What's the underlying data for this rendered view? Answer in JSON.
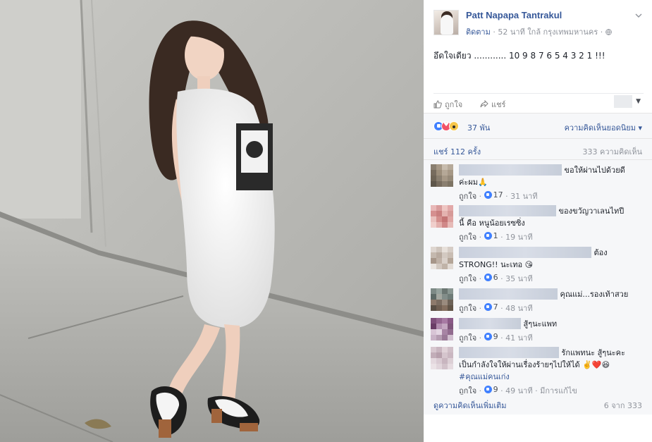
{
  "post": {
    "author": "Patt Napapa Tantrakul",
    "follow_label": "ติดตาม",
    "meta": " · 52 นาที ใกล้ กรุงเทพมหานคร ·",
    "text": "อึดใจเดียว ............ 10 9 8 7 6 5 4 3 2 1 !!!",
    "like_label": "ถูกใจ",
    "share_label": "แชร์",
    "reaction_count": "37 พัน",
    "top_comments_label": "ความคิดเห็นยอดนิยม ▾",
    "shares": "แชร์ 112 ครั้ง",
    "comment_count": "333 ความคิดเห็น",
    "more_comments": "ดูความคิดเห็นเพิ่มเติม",
    "page_count": "6 จาก 333"
  },
  "comments": [
    {
      "text_a": "ขอให้ผ่านไปด้วยดี",
      "text_b": "ค่ะผม🙏",
      "like": "ถูกใจ",
      "count": "17",
      "time": "31 นาที",
      "edited": ""
    },
    {
      "text_a": "ของขวัญวาเลนไทปี",
      "text_b": "นี้ คือ หนูน้อยเรซซิ่ง",
      "like": "ถูกใจ",
      "count": "1",
      "time": "19 นาที",
      "edited": ""
    },
    {
      "text_a": "ต้อง",
      "text_b": "STRONG!! นะเทอ 😘",
      "like": "ถูกใจ",
      "count": "6",
      "time": "35 นาที",
      "edited": ""
    },
    {
      "text_a": "คุณแม่...รองเท้าสวย",
      "text_b": "",
      "like": "ถูกใจ",
      "count": "7",
      "time": "48 นาที",
      "edited": ""
    },
    {
      "text_a": "สู้ๆนะแพท",
      "text_b": "",
      "like": "ถูกใจ",
      "count": "9",
      "time": "41 นาที",
      "edited": ""
    },
    {
      "text_a": "รักแพทนะ สู้ๆนะคะ",
      "text_b": "เป็นกำลังใจให้ผ่านเรื่องร้ายๆไปให้ได้ ✌️❤️😆",
      "hashtag": "#คุณแม่คนเก่ง",
      "like": "ถูกใจ",
      "count": "9",
      "time": "49 นาที",
      "edited": " · มีการแก้ไข"
    }
  ],
  "colors": {
    "link": "#365899",
    "muted": "#90949c",
    "panel_bg": "#f6f7f9",
    "like_blue": "#4080ff",
    "love_red": "#f25268"
  },
  "icons": {
    "chevron": "chevron-down-icon",
    "like": "thumbs-up-icon",
    "share": "share-arrow-icon",
    "globe": "globe-icon"
  }
}
